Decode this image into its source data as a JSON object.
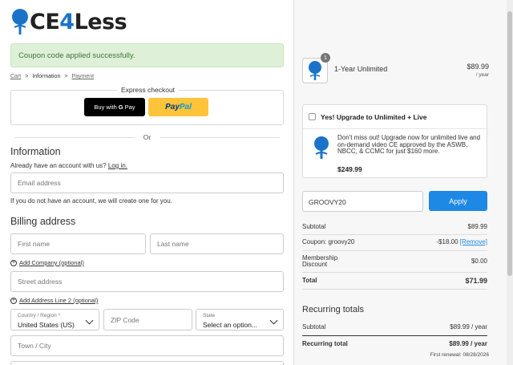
{
  "logo": {
    "prefix": "CE",
    "four": "4",
    "suffix": "Less"
  },
  "alert": {
    "message": "Coupon code applied successfully."
  },
  "breadcrumb": {
    "cart": "Cart",
    "sep1": ">",
    "information": "Information",
    "sep2": ">",
    "payment": "Payment"
  },
  "express": {
    "title": "Express checkout",
    "gpay_prefix": "Buy with",
    "gpay_g": "G",
    "gpay_pay": "Pay",
    "paypal_pay": "Pay",
    "paypal_pal": "Pal"
  },
  "or_label": "Or",
  "information": {
    "heading": "Information",
    "account_prompt": "Already have an account with us?",
    "login_link": "Log in.",
    "email_placeholder": "Email address",
    "no_account_note": "If you do not have an account, we will create one for you."
  },
  "billing": {
    "heading": "Billing address",
    "first_name_placeholder": "First name",
    "last_name_placeholder": "Last name",
    "add_company": "Add Company (optional)",
    "street_placeholder": "Street address",
    "add_line2": "Add Address Line 2 (optional)",
    "country_label": "Country / Region *",
    "country_value": "United States (US)",
    "zip_placeholder": "ZIP Code",
    "state_label": "State",
    "state_value": "Select an option...",
    "city_placeholder": "Town / City"
  },
  "order": {
    "quantity": "1",
    "product_name": "1-Year Unlimited",
    "product_price": "$89.99",
    "product_period": "/ year",
    "upsell_title": "Yes! Upgrade to Unlimited + Live",
    "upsell_text": "Don't miss out! Upgrade now for unlimited live and on-demand video CE approved by the ASWB, NBCC, & CCMC for just $160 more.",
    "upsell_price": "$249.99",
    "coupon_value": "GROOVY20",
    "apply_label": "Apply",
    "subtotal_label": "Subtotal",
    "subtotal_value": "$89.99",
    "coupon_label": "Coupon: groovy20",
    "coupon_amount": "-$18.00",
    "remove_label": "[Remove]",
    "membership_label_1": "Membership",
    "membership_label_2": "Discount",
    "membership_value": "$0.00",
    "total_label": "Total",
    "total_value": "$71.99",
    "recurring_heading": "Recurring totals",
    "rec_subtotal_label": "Subtotal",
    "rec_subtotal_value": "$89.99 / year",
    "rec_total_label": "Recurring total",
    "rec_total_value": "$89.99 / year",
    "first_renewal": "First renewal: 08/28/2026"
  },
  "colors": {
    "accent": "#1e88e5",
    "success_bg": "#dff0d8",
    "success_text": "#3c763d",
    "paypal_yellow": "#ffc439"
  }
}
